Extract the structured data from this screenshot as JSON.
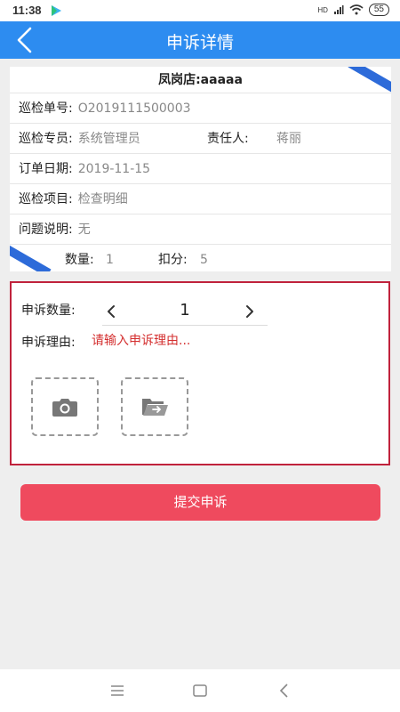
{
  "status_bar": {
    "time": "11:38",
    "battery": "55",
    "network": "HD"
  },
  "header": {
    "title": "申诉详情"
  },
  "store": {
    "title": "凤岗店:aaaaa"
  },
  "info": {
    "inspection_no_label": "巡检单号:",
    "inspection_no": "O2019111500003",
    "inspector_label": "巡检专员:",
    "inspector": "系统管理员",
    "responsible_label": "责任人:",
    "responsible": "蒋丽",
    "order_date_label": "订单日期:",
    "order_date": "2019-11-15",
    "item_label": "巡检项目:",
    "item": "检查明细",
    "issue_label": "问题说明:",
    "issue": "无",
    "quantity_label": "数量:",
    "quantity": "1",
    "deduction_label": "扣分:",
    "deduction": "5"
  },
  "appeal": {
    "quantity_label": "申诉数量:",
    "quantity_value": "1",
    "reason_label": "申诉理由:",
    "reason_placeholder": "请输入申诉理由..."
  },
  "submit_label": "提交申诉",
  "colors": {
    "primary": "#2d8cf0",
    "danger": "#ef4a5e",
    "border_red": "#c0223c"
  }
}
